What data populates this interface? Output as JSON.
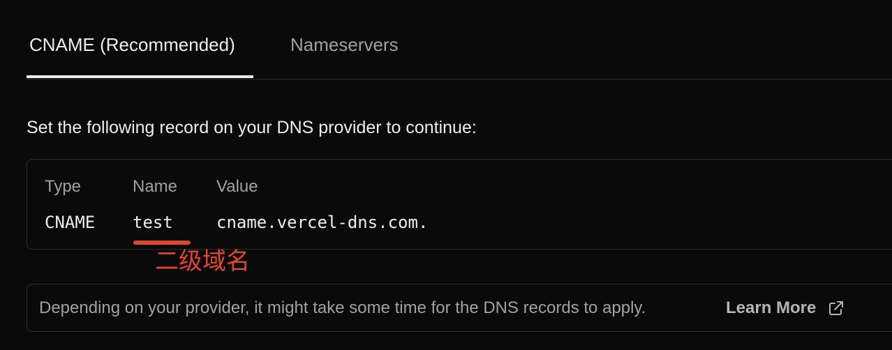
{
  "tabs": {
    "cname": "CNAME (Recommended)",
    "nameservers": "Nameservers",
    "active": "cname"
  },
  "instruction": "Set the following record on your DNS provider to continue:",
  "record": {
    "headers": {
      "type": "Type",
      "name": "Name",
      "value": "Value"
    },
    "type": "CNAME",
    "name": "test",
    "value": "cname.vercel-dns.com."
  },
  "annotation": {
    "text": "二级域名",
    "color": "#e0452f"
  },
  "note": {
    "text": "Depending on your provider, it might take some time for the DNS records to apply.",
    "link_label": "Learn More",
    "link_icon": "external-link-icon"
  },
  "colors": {
    "background": "#0a0a0a",
    "text_primary": "#ededed",
    "text_secondary": "#a1a1a1",
    "border": "#2e2e2e"
  }
}
